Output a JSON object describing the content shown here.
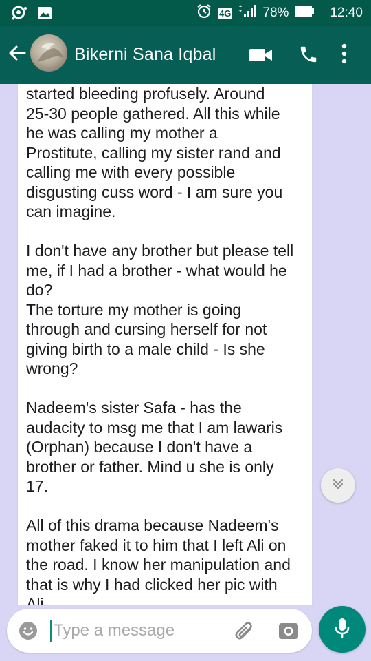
{
  "status_bar": {
    "network": "4G",
    "battery": "78%",
    "time": "12:40"
  },
  "header": {
    "contact_name": "Bikerni Sana Iqbal",
    "icons": [
      "back-arrow-icon",
      "video-call-icon",
      "phone-icon",
      "more-vert-icon"
    ]
  },
  "chat": {
    "message_text": "started bleeding profusely. Around\n25-30 people gathered. All this while\nhe was calling my mother a\nProstitute, calling my sister rand and\ncalling me with every possible\ndisgusting cuss word - I am sure you\ncan imagine.\n\nI don't have any brother but please tell\nme, if I had a brother - what would he\ndo?\nThe torture my mother is going\nthrough and cursing herself for not\ngiving birth to a male child - Is she\nwrong?\n\nNadeem's sister Safa - has the\naudacity to msg me that I am lawaris\n(Orphan) because I don't have a\nbrother or father. Mind u she is only\n17.\n\nAll of this drama because Nadeem's\nmother faked it to him that I left Ali on\nthe road. I know her manipulation and\nthat is why I had clicked her pic with\nAli"
  },
  "composer": {
    "placeholder": "Type a message"
  },
  "colors": {
    "header": "#075e54",
    "status_bar": "#035a4b",
    "chat_background": "#d9d6f5",
    "accent": "#00897b"
  }
}
